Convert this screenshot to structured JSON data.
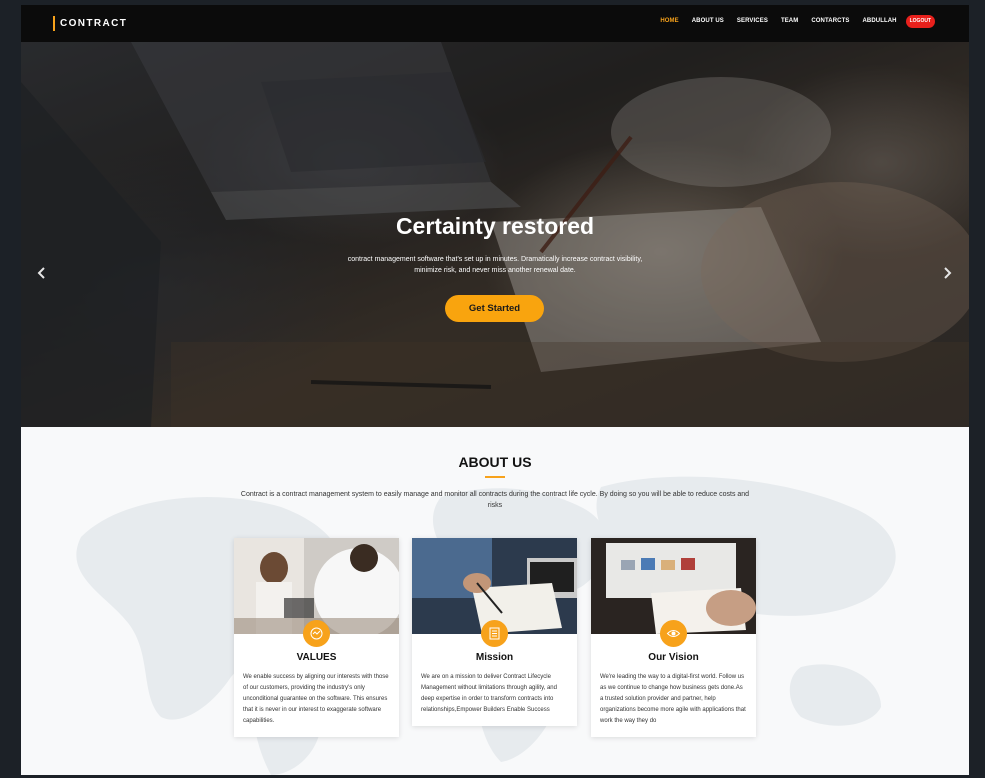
{
  "nav": {
    "logo": "CONTRACT",
    "items": [
      {
        "label": "HOME",
        "active": true
      },
      {
        "label": "ABOUT US",
        "active": false
      },
      {
        "label": "SERVICES",
        "active": false
      },
      {
        "label": "TEAM",
        "active": false
      },
      {
        "label": "CONTARCTS",
        "active": false
      },
      {
        "label": "ABDULLAH",
        "active": false
      }
    ],
    "logout": "LOGOUT"
  },
  "hero": {
    "title": "Certainty restored",
    "subtitle": "contract management software that's set up in minutes. Dramatically increase contract visibility, minimize risk, and never miss another renewal date.",
    "cta": "Get Started",
    "prev_icon": "chevron-left-icon",
    "next_icon": "chevron-right-icon"
  },
  "about": {
    "title": "ABOUT US",
    "description": "Contract is a contract management system to easily manage and monitor all contracts during the contract life cycle. By doing so you will be able to reduce costs and risks",
    "cards": [
      {
        "title": "VALUES",
        "icon": "handshake-icon",
        "text": "We enable success by aligning our interests with those of our customers, providing the industry's only unconditional guarantee on the software. This ensures that it is never in our interest to exaggerate software capabilities."
      },
      {
        "title": "Mission",
        "icon": "document-icon",
        "text": "We are on a mission to deliver Contract Lifecycle Management without limitations through agility, and deep expertise in order to transform contracts into relationships,Empower Builders Enable Success"
      },
      {
        "title": "Our Vision",
        "icon": "eye-icon",
        "text": "We're leading the way to a digital-first world. Follow us as we continue to change how business gets done.As a trusted solution provider and partner, help organizations become more agile with applications that work the way they do"
      }
    ]
  },
  "colors": {
    "accent": "#f7a21b",
    "logout": "#e8201c",
    "nav_bg": "#0b0b0b",
    "page_bg": "#1c2127"
  }
}
